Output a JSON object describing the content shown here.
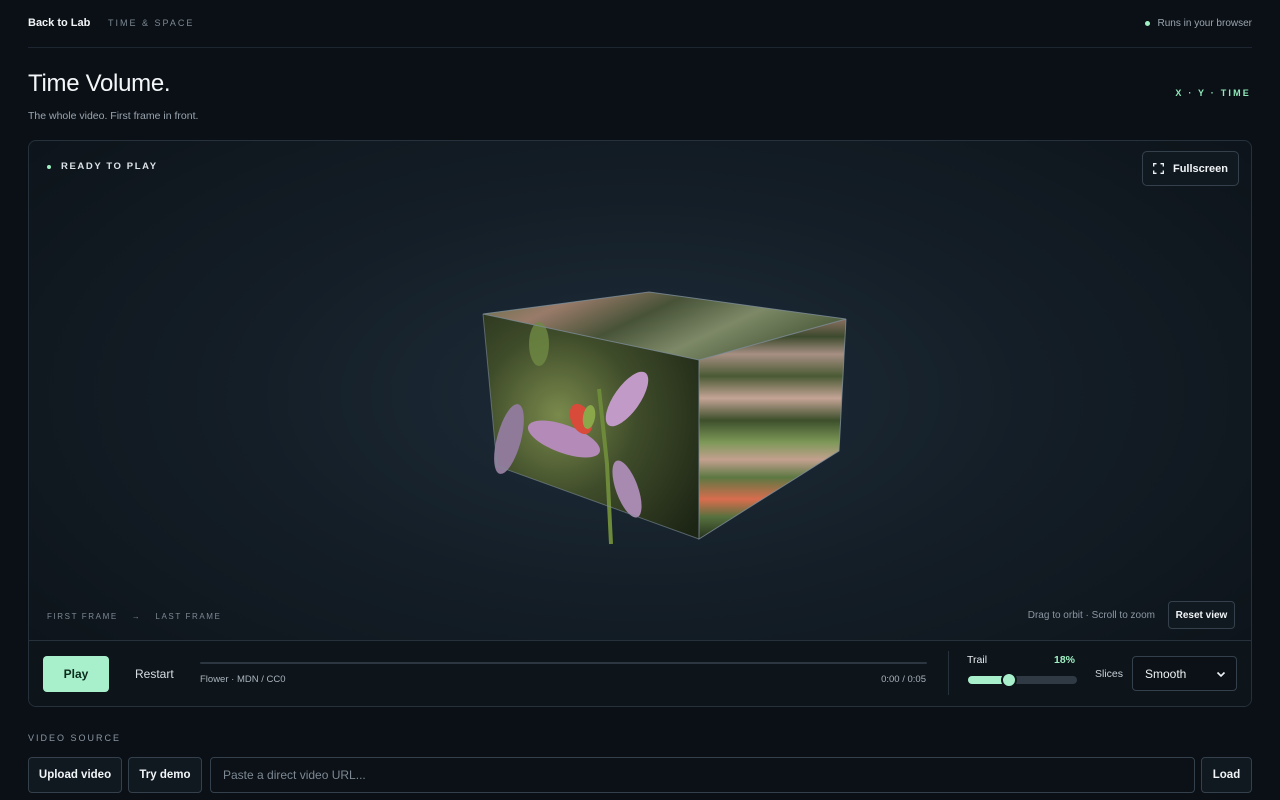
{
  "header": {
    "back_label": "Back to Lab",
    "section": "TIME & SPACE",
    "runs_label": "Runs in your browser"
  },
  "hero": {
    "title": "Time Volume.",
    "subtitle": "The whole video. First frame in front.",
    "axes_label": "X · Y · TIME"
  },
  "stage": {
    "status": "READY TO PLAY",
    "fullscreen_label": "Fullscreen",
    "first_frame": "FIRST FRAME",
    "arrow": "→",
    "last_frame": "LAST FRAME",
    "hint": "Drag to orbit · Scroll to zoom",
    "reset_label": "Reset view"
  },
  "controls": {
    "play_label": "Play",
    "restart_label": "Restart",
    "progress": 0,
    "source_credit": "Flower · MDN / CC0",
    "time": "0:00 / 0:05",
    "trail_label": "Trail",
    "trail_value": "18%",
    "trail_level": 0.38,
    "slices_label": "Slices",
    "slices_selected": "Smooth"
  },
  "video_source": {
    "label": "VIDEO SOURCE",
    "upload_label": "Upload video",
    "demo_label": "Try demo",
    "url_placeholder": "Paste a direct video URL...",
    "url_value": "",
    "load_label": "Load"
  },
  "colors": {
    "accent": "#a8f0cb",
    "background": "#0b1016"
  }
}
